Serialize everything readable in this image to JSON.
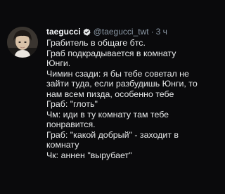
{
  "tweet": {
    "author_name": "taegucci",
    "handle": "@taegucci_twt",
    "separator": "·",
    "time": "3 ч",
    "lines": [
      "Грабитель в общаге бтс.",
      "Граб подкрадывается в комнату",
      "Юнги.",
      "Чимин сзади: я бы тебе советал не",
      "зайти туда, если разбудишь Юнги, то",
      "нам всем пизда, особенно тебе",
      "Граб: \"глоть\"",
      "Чм: иди в ту комнату там тебе",
      "понравится.",
      "Граб: \"какой добрый\" - заходит в",
      "комнату",
      "Чк: аннен \"вырубает\""
    ]
  },
  "colors": {
    "background": "#0a0a0c",
    "text": "#e7e9ea",
    "muted": "#8b98a5",
    "verified": "#e7e9ea"
  },
  "icons": {
    "verified": "verified-badge-icon",
    "avatar": "profile-photo"
  }
}
